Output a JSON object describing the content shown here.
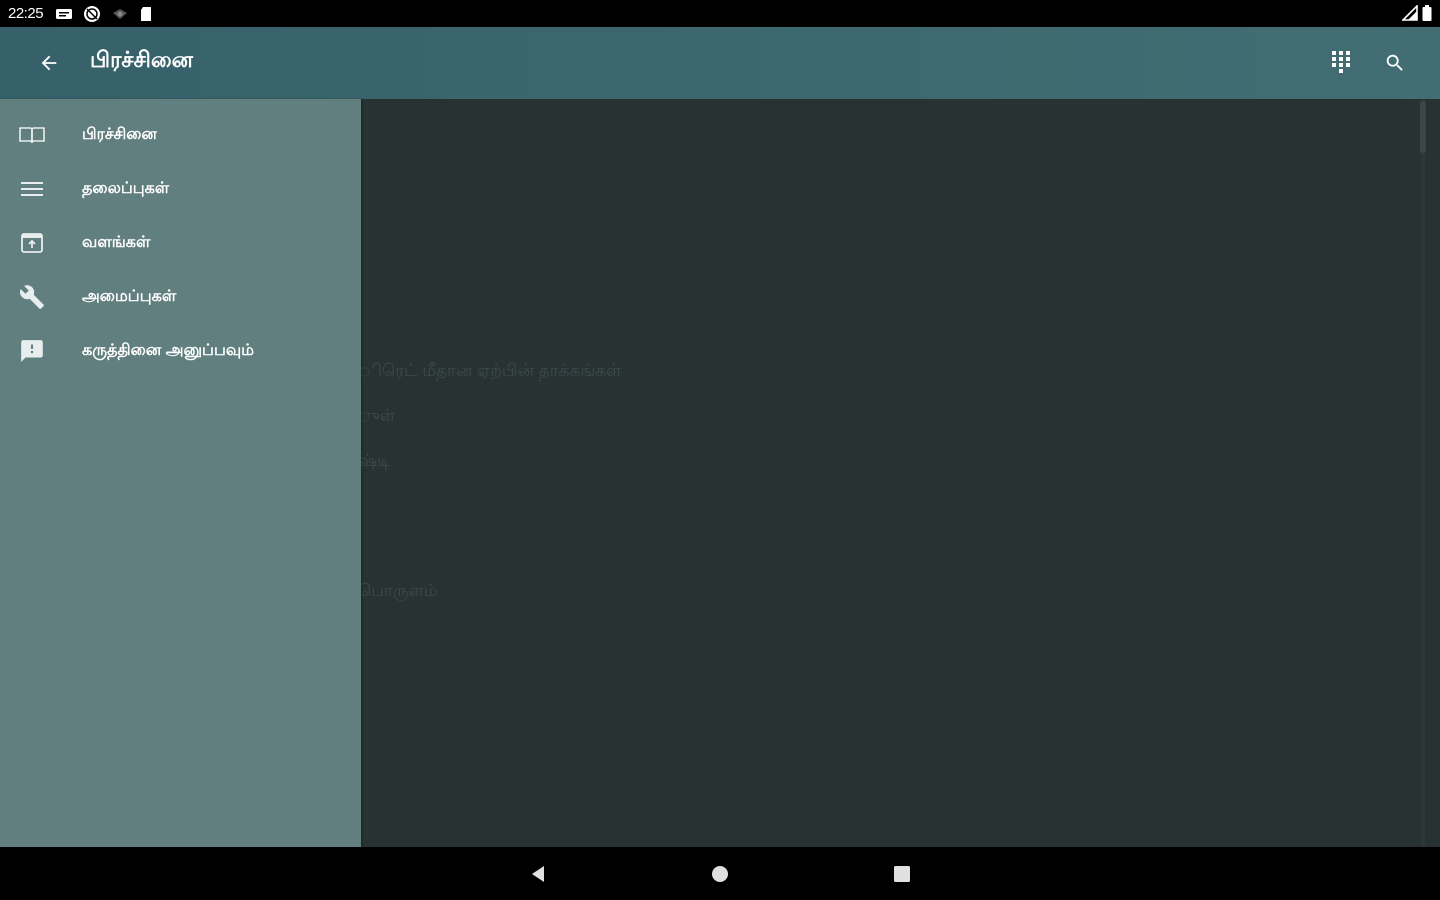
{
  "status_bar": {
    "time": "22:25"
  },
  "app_bar": {
    "title": "பிரச்சினை",
    "icons": {
      "back": "arrow-back-icon",
      "grid": "dialpad-grid-icon",
      "search": "search-icon"
    }
  },
  "drawer": {
    "items": [
      {
        "label": "பிரச்சினை",
        "icon": "book-icon"
      },
      {
        "label": "தலைப்புகள்",
        "icon": "list-icon"
      },
      {
        "label": "வளங்கள்",
        "icon": "resources-box-icon"
      },
      {
        "label": "அமைப்புகள்",
        "icon": "wrench-icon"
      },
      {
        "label": "கருத்தினை அனுப்பவும்",
        "icon": "feedback-icon"
      }
    ]
  },
  "content": {
    "lines": [
      "ிரெட் மீதான ஏற்பின் தாக்கங்கள்",
      "ுள்",
      "ஷ்டி",
      "பொருளம்"
    ]
  },
  "colors": {
    "app_bar": "#416d73",
    "drawer": "#627f80",
    "content_bg": "#283233"
  }
}
